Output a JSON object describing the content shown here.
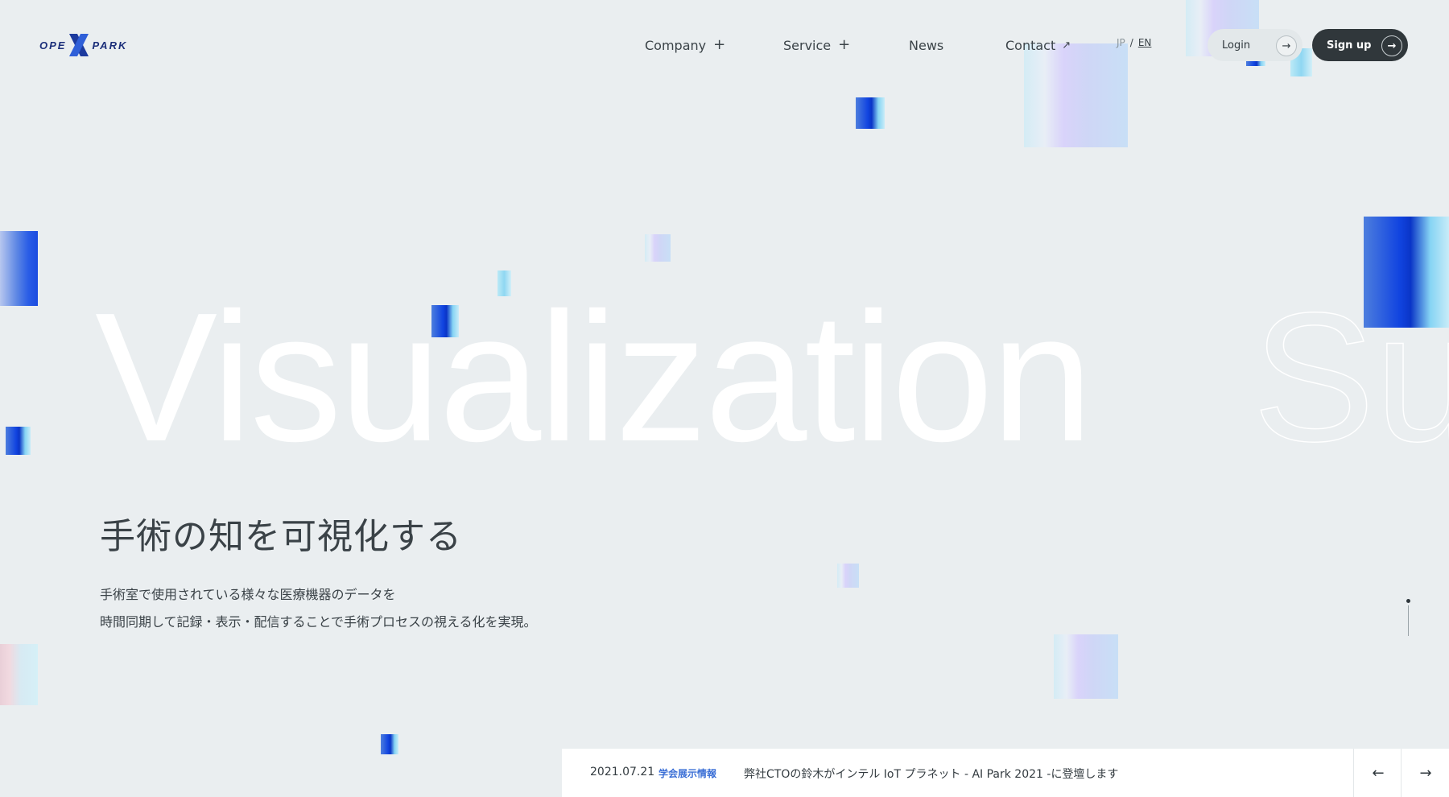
{
  "header": {
    "logo": {
      "left": "OPE",
      "right": "PARK"
    },
    "nav": [
      {
        "label": "Company",
        "mark": "+"
      },
      {
        "label": "Service",
        "mark": "+"
      },
      {
        "label": "News",
        "mark": ""
      },
      {
        "label": "Contact",
        "mark": "↗"
      }
    ],
    "lang": {
      "jp": "JP",
      "separator": "/",
      "en": "EN"
    },
    "login": {
      "label": "Login",
      "arrow": "→"
    },
    "signup": {
      "label": "Sign up",
      "arrow": "→"
    }
  },
  "hero": {
    "word": "Visualization",
    "next_word": "Su",
    "headline": "手術の知を可視化する",
    "description": [
      "手術室で使用されている様々な医療機器のデータを",
      "時間同期して記録・表示・配信することで手術プロセスの視える化を実現。"
    ]
  },
  "news": {
    "date": "2021.07.21",
    "category": "学会展示情報",
    "title": "弊社CTOの鈴木がインテル IoT プラネット - AI Park 2021 -に登壇します",
    "prev_arrow": "←",
    "next_arrow": "→"
  },
  "colors": {
    "background": "#eaeef0",
    "accent_blue": "#0a35c7",
    "category_blue": "#3b6fd6",
    "dark_button": "#30373b"
  }
}
